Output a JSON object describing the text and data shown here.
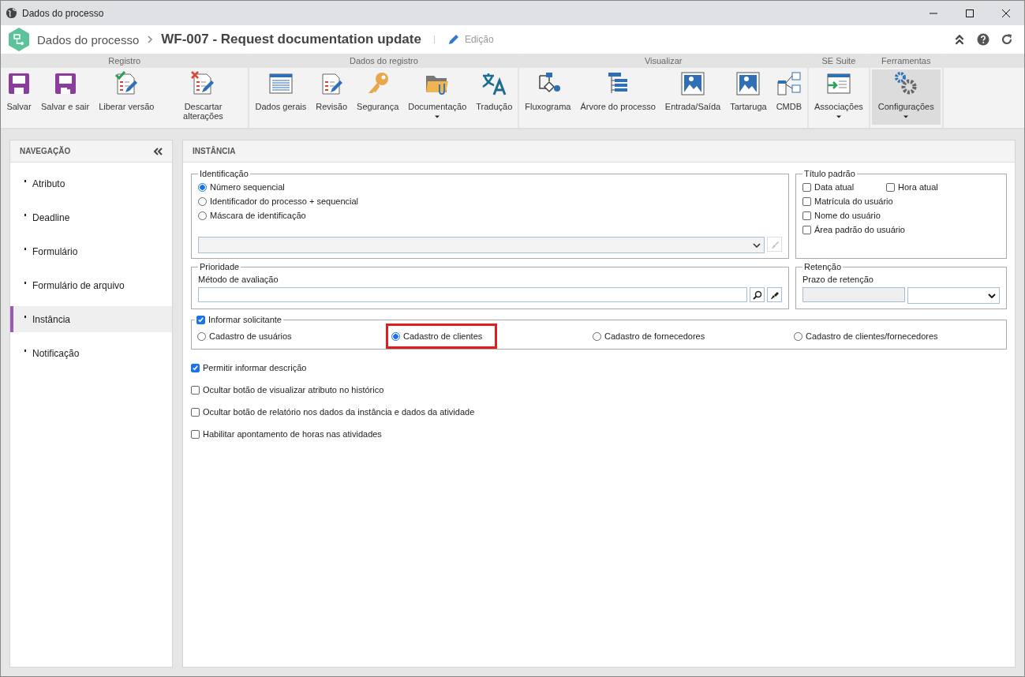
{
  "window": {
    "title": "Dados do processo"
  },
  "header": {
    "breadcrumb": "Dados do processo",
    "title": "WF-007 - Request documentation update",
    "mode": "Edição"
  },
  "ribbon": [
    {
      "label": "Registro",
      "buttons": [
        {
          "kind": "save",
          "label": "Salvar",
          "dropdown": false,
          "selected": false
        },
        {
          "kind": "save-exit",
          "label": "Salvar e sair",
          "dropdown": false,
          "selected": false
        },
        {
          "kind": "release",
          "label": "Liberar versão",
          "dropdown": false,
          "selected": false
        },
        {
          "kind": "discard",
          "label": "Descartar alterações",
          "dropdown": false,
          "selected": false
        }
      ]
    },
    {
      "label": "Dados do registro",
      "buttons": [
        {
          "kind": "form",
          "label": "Dados gerais",
          "dropdown": false,
          "selected": false
        },
        {
          "kind": "revision",
          "label": "Revisão",
          "dropdown": false,
          "selected": false
        },
        {
          "kind": "key",
          "label": "Segurança",
          "dropdown": false,
          "selected": false
        },
        {
          "kind": "folder",
          "label": "Documentação",
          "dropdown": true,
          "selected": false
        },
        {
          "kind": "translate",
          "label": "Tradução",
          "dropdown": false,
          "selected": false
        }
      ]
    },
    {
      "label": "Visualizar",
      "buttons": [
        {
          "kind": "flow",
          "label": "Fluxograma",
          "dropdown": false,
          "selected": false
        },
        {
          "kind": "tree",
          "label": "Árvore do processo",
          "dropdown": false,
          "selected": false
        },
        {
          "kind": "image",
          "label": "Entrada/Saída",
          "dropdown": false,
          "selected": false
        },
        {
          "kind": "image",
          "label": "Tartaruga",
          "dropdown": false,
          "selected": false
        },
        {
          "kind": "cmdb",
          "label": "CMDB",
          "dropdown": false,
          "selected": false
        }
      ]
    },
    {
      "label": "SE Suite",
      "buttons": [
        {
          "kind": "assoc",
          "label": "Associações",
          "dropdown": true,
          "selected": false
        }
      ]
    },
    {
      "label": "Ferramentas",
      "buttons": [
        {
          "kind": "gears",
          "label": "Configurações",
          "dropdown": true,
          "selected": true
        }
      ]
    }
  ],
  "nav": {
    "title": "NAVEGAÇÃO",
    "items": [
      {
        "label": "Atributo",
        "selected": false
      },
      {
        "label": "Deadline",
        "selected": false
      },
      {
        "label": "Formulário",
        "selected": false
      },
      {
        "label": "Formulário de arquivo",
        "selected": false
      },
      {
        "label": "Instância",
        "selected": true
      },
      {
        "label": "Notificação",
        "selected": false
      }
    ]
  },
  "panel": {
    "title": "INSTÂNCIA",
    "identificacao": {
      "legend": "Identificação",
      "options": [
        {
          "label": "Número sequencial",
          "selected": true
        },
        {
          "label": "Identificador do processo + sequencial",
          "selected": false
        },
        {
          "label": "Máscara de identificação",
          "selected": false
        }
      ]
    },
    "titulo_padrao": {
      "legend": "Título padrão",
      "options": [
        {
          "label": "Data atual",
          "checked": false
        },
        {
          "label": "Hora atual",
          "checked": false
        },
        {
          "label": "Matrícula do usuário",
          "checked": false
        },
        {
          "label": "Nome do usuário",
          "checked": false
        },
        {
          "label": "Área padrão do usuário",
          "checked": false
        }
      ]
    },
    "prioridade": {
      "legend": "Prioridade",
      "field_label": "Método de avaliação"
    },
    "retencao": {
      "legend": "Retenção",
      "field_label": "Prazo de retenção"
    },
    "solicitante": {
      "label": "Informar solicitante",
      "checked": true,
      "options": [
        {
          "label": "Cadastro de usuários",
          "selected": false,
          "highlighted": false
        },
        {
          "label": "Cadastro de clientes",
          "selected": true,
          "highlighted": true
        },
        {
          "label": "Cadastro de fornecedores",
          "selected": false,
          "highlighted": false
        },
        {
          "label": "Cadastro de clientes/fornecedores",
          "selected": false,
          "highlighted": false
        }
      ]
    },
    "options": [
      {
        "label": "Permitir informar descrição",
        "checked": true
      },
      {
        "label": "Ocultar botão de visualizar atributo no histórico",
        "checked": false
      },
      {
        "label": "Ocultar botão de relatório nos dados da instância e dados da atividade",
        "checked": false
      },
      {
        "label": "Habilitar apontamento de horas nas atividades",
        "checked": false
      }
    ]
  }
}
